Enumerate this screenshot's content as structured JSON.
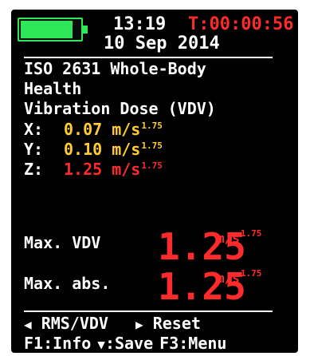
{
  "status": {
    "battery_level": 0.88,
    "battery_color": "#2ee85a",
    "time": "13:19",
    "timer": "T:00:00:56",
    "date": "10 Sep  2014"
  },
  "measurement": {
    "title_line1": "ISO 2631 Whole-Body",
    "title_line2": "Health",
    "title_line3": "Vibration Dose (VDV)",
    "unit": "m/s",
    "unit_exponent": "1.75",
    "axes": [
      {
        "label": "X:",
        "value": "0.07",
        "color": "#ffcc33"
      },
      {
        "label": "Y:",
        "value": "0.10",
        "color": "#ffcc33"
      },
      {
        "label": "Z:",
        "value": "1.25",
        "color": "#ff2a2a"
      }
    ]
  },
  "results": {
    "max_vdv_label": "Max. VDV",
    "max_vdv_value": "1.25",
    "max_abs_label": "Max. abs.",
    "max_abs_value": "1.25",
    "value_color": "#ff2a2a"
  },
  "footer": {
    "left_arrow_icon": "triangle-left-icon",
    "rms_vdv_label": "RMS/VDV",
    "right_arrow_icon": "triangle-right-icon",
    "reset_label": "Reset",
    "f1_label": "F1:Info",
    "down_arrow_icon": "triangle-down-icon",
    "save_label": ":Save",
    "f3_label": "F3:Menu"
  }
}
